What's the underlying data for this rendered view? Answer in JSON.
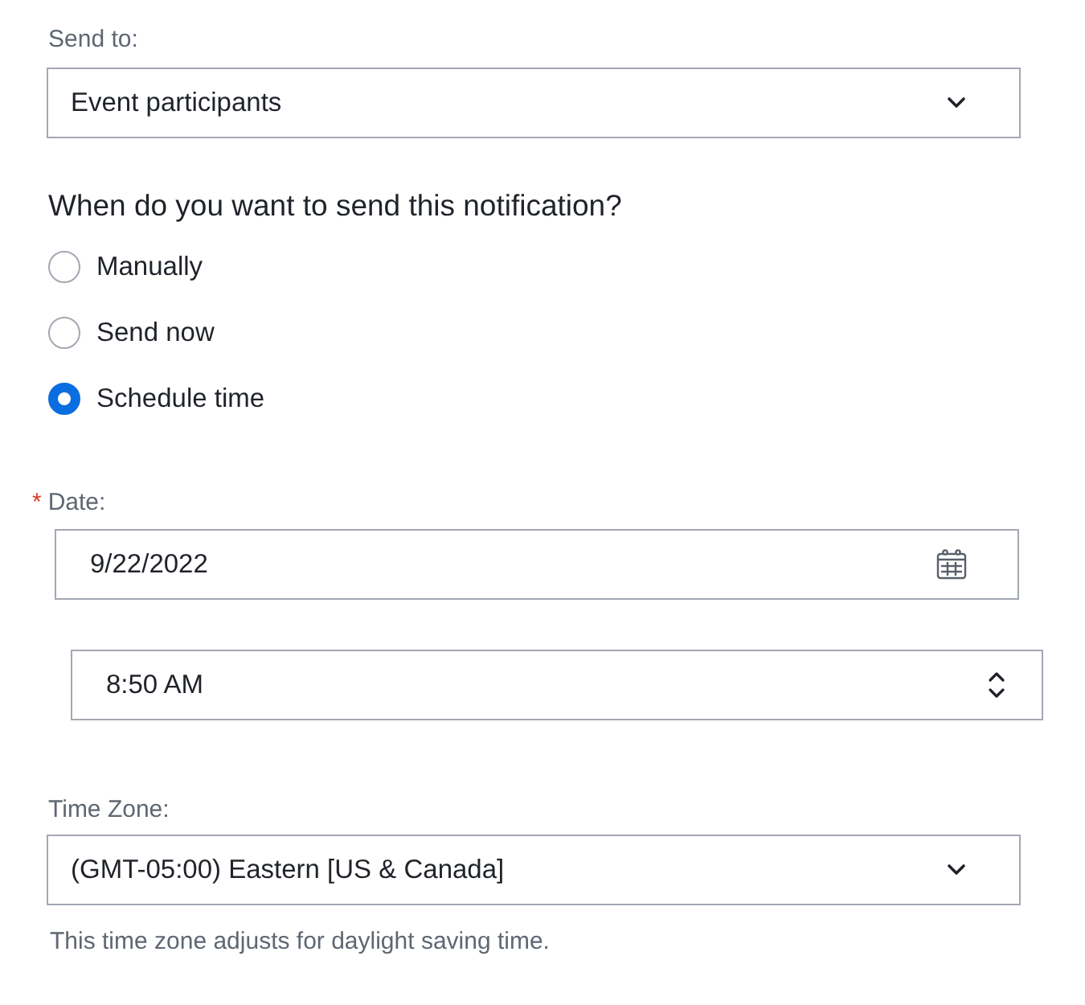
{
  "send_to": {
    "label": "Send to:",
    "value": "Event participants"
  },
  "schedule": {
    "question": "When do you want to send this notification?",
    "options": [
      {
        "label": "Manually",
        "selected": false
      },
      {
        "label": "Send now",
        "selected": false
      },
      {
        "label": "Schedule time",
        "selected": true
      }
    ]
  },
  "date": {
    "required_mark": "*",
    "label": "Date:",
    "value": "9/22/2022"
  },
  "time": {
    "value": "8:50 AM"
  },
  "time_zone": {
    "label": "Time Zone:",
    "value": "(GMT-05:00) Eastern [US & Canada]",
    "help": "This time zone adjusts for daylight saving time."
  }
}
